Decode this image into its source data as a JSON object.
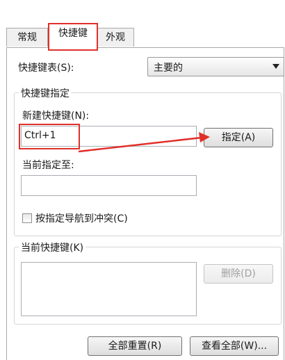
{
  "tabs": [
    {
      "label": "常规"
    },
    {
      "label": "快捷键"
    },
    {
      "label": "外观"
    }
  ],
  "shortcut_table": {
    "label": "快捷键表(S):",
    "selected": "主要的"
  },
  "assign_group": {
    "title": "快捷键指定",
    "new_shortcut_label": "新建快捷键(N):",
    "new_shortcut_value": "Ctrl+1",
    "assign_button": "指定(A)",
    "current_assigned_label": "当前指定至:",
    "current_assigned_value": "",
    "conflict_checkbox_label": "按指定导航到冲突(C)",
    "conflict_checked": false
  },
  "current_group": {
    "title": "当前快捷键(K)",
    "delete_button": "删除(D)"
  },
  "footer": {
    "reset_all_button": "全部重置(R)",
    "view_all_button": "查看全部(W)..."
  },
  "annotation": {
    "highlight_color": "#e0302a"
  }
}
